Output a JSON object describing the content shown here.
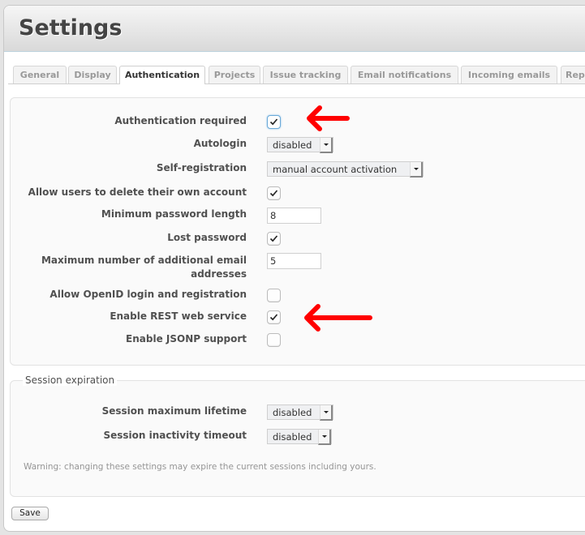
{
  "page": {
    "title": "Settings"
  },
  "tabs": [
    {
      "label": "General",
      "active": false
    },
    {
      "label": "Display",
      "active": false
    },
    {
      "label": "Authentication",
      "active": true
    },
    {
      "label": "Projects",
      "active": false
    },
    {
      "label": "Issue tracking",
      "active": false
    },
    {
      "label": "Email notifications",
      "active": false
    },
    {
      "label": "Incoming emails",
      "active": false
    },
    {
      "label": "Rep",
      "active": false
    }
  ],
  "auth": {
    "authentication_required": {
      "label": "Authentication required",
      "checked": true
    },
    "autologin": {
      "label": "Autologin",
      "value": "disabled"
    },
    "self_registration": {
      "label": "Self-registration",
      "value": "manual account activation"
    },
    "allow_delete_account": {
      "label": "Allow users to delete their own account",
      "checked": true
    },
    "min_password_length": {
      "label": "Minimum password length",
      "value": "8"
    },
    "lost_password": {
      "label": "Lost password",
      "checked": true
    },
    "max_additional_emails": {
      "label_line1": "Maximum number of additional email",
      "label_line2": "addresses",
      "value": "5"
    },
    "openid": {
      "label": "Allow OpenID login and registration",
      "checked": false
    },
    "rest_api": {
      "label": "Enable REST web service",
      "checked": true
    },
    "jsonp": {
      "label": "Enable JSONP support",
      "checked": false
    }
  },
  "session": {
    "legend": "Session expiration",
    "max_lifetime": {
      "label": "Session maximum lifetime",
      "value": "disabled"
    },
    "inactivity_timeout": {
      "label": "Session inactivity timeout",
      "value": "disabled"
    },
    "warning": "Warning: changing these settings may expire the current sessions including yours."
  },
  "actions": {
    "save_label": "Save"
  },
  "annotations": {
    "arrow_color": "#ff0000"
  }
}
